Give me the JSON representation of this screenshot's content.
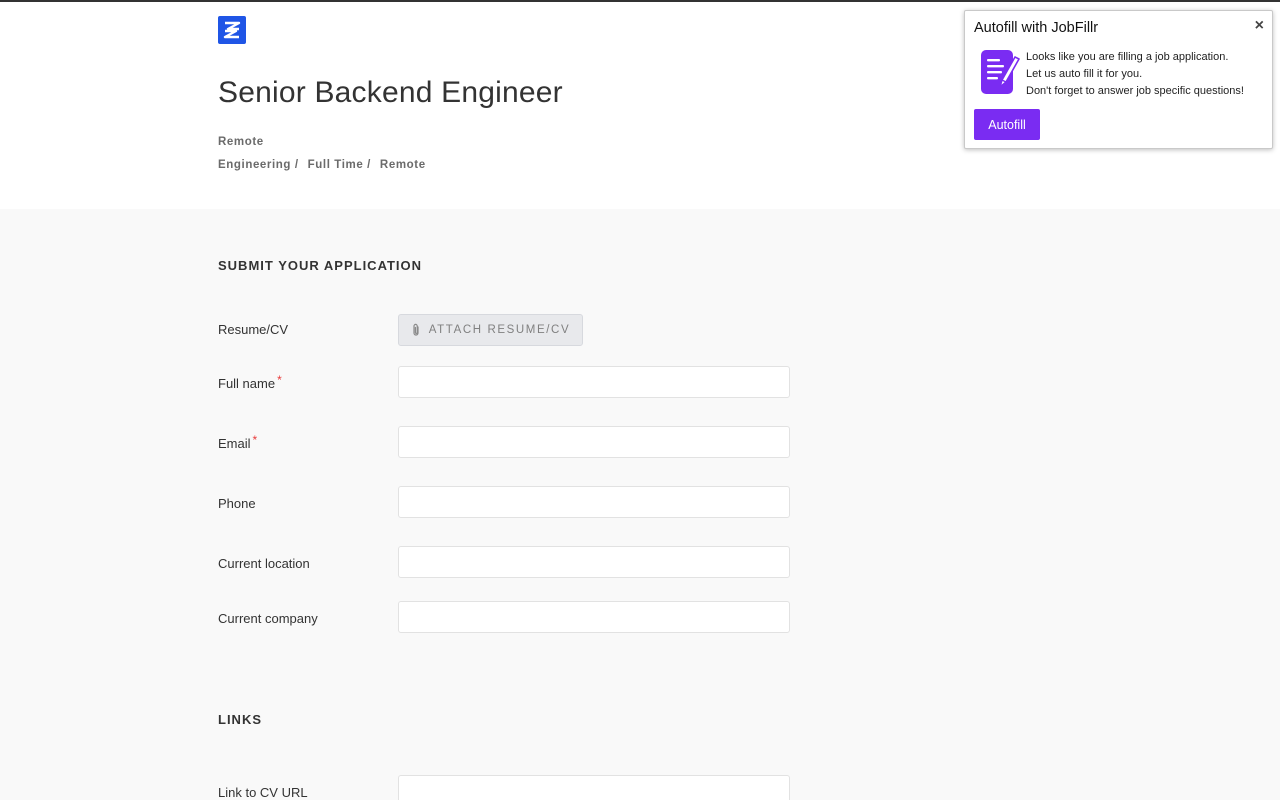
{
  "job": {
    "title": "Senior Backend Engineer",
    "location": "Remote",
    "categories": [
      "Engineering /",
      "Full Time /",
      "Remote"
    ]
  },
  "application": {
    "heading": "SUBMIT YOUR APPLICATION",
    "resume_label": "Resume/CV",
    "attach_label": "ATTACH RESUME/CV",
    "required_mark": "*",
    "fields": {
      "full_name": {
        "label": "Full name",
        "value": ""
      },
      "email": {
        "label": "Email",
        "value": ""
      },
      "phone": {
        "label": "Phone",
        "value": ""
      },
      "current_location": {
        "label": "Current location",
        "value": ""
      },
      "current_company": {
        "label": "Current company",
        "value": ""
      }
    }
  },
  "links": {
    "heading": "LINKS",
    "cv_url_label": "Link to CV URL"
  },
  "popup": {
    "title": "Autofill with JobFillr",
    "close": "×",
    "lines": [
      "Looks like you are filling a job application.",
      "Let us auto fill it for you.",
      "Don't forget to answer job specific questions!"
    ],
    "button": "Autofill",
    "accent": "#7a2cf2"
  },
  "colors": {
    "logo": "#1f55e6",
    "required": "#e83a3a"
  },
  "icons": {
    "logo": "company-logo-icon",
    "attach": "paperclip-icon",
    "popup": "document-pen-icon"
  }
}
